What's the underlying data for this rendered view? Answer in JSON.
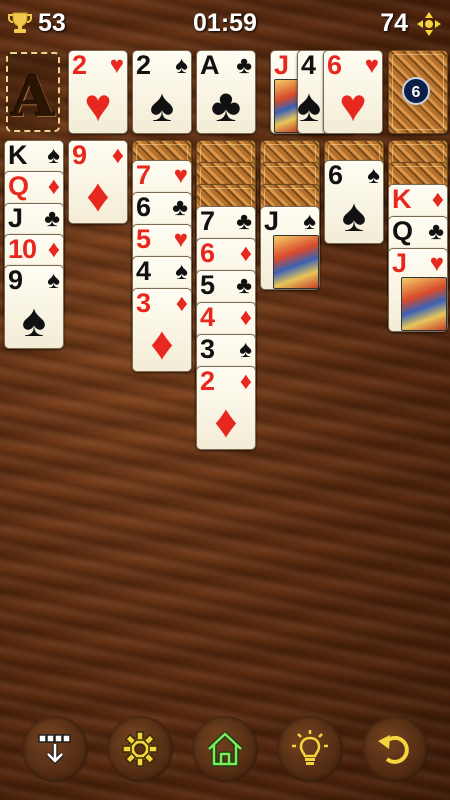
{
  "hud": {
    "score": "53",
    "timer": "01:59",
    "moves": "74"
  },
  "foundation": {
    "placeholder": "A"
  },
  "stock": {
    "remaining": "6"
  },
  "waste": [
    {
      "rank": "J",
      "suit": "♠",
      "color": "red"
    },
    {
      "rank": "4",
      "suit": "♠",
      "color": "black"
    },
    {
      "rank": "6",
      "suit": "♥",
      "color": "red"
    }
  ],
  "top_cards": [
    {
      "rank": "2",
      "suit": "♥",
      "color": "red"
    },
    {
      "rank": "2",
      "suit": "♠",
      "color": "black"
    },
    {
      "rank": "A",
      "suit": "♣",
      "color": "black"
    }
  ],
  "tableau": {
    "col1": [
      {
        "rank": "K",
        "suit": "♠",
        "color": "black"
      },
      {
        "rank": "Q",
        "suit": "♦",
        "color": "red"
      },
      {
        "rank": "J",
        "suit": "♣",
        "color": "black"
      },
      {
        "rank": "10",
        "suit": "♦",
        "color": "red"
      },
      {
        "rank": "9",
        "suit": "♠",
        "color": "black"
      }
    ],
    "col2": [
      {
        "rank": "9",
        "suit": "♦",
        "color": "red"
      }
    ],
    "col3": [
      {
        "rank": "7",
        "suit": "♥",
        "color": "red"
      },
      {
        "rank": "6",
        "suit": "♣",
        "color": "black"
      },
      {
        "rank": "5",
        "suit": "♥",
        "color": "red"
      },
      {
        "rank": "4",
        "suit": "♠",
        "color": "black"
      },
      {
        "rank": "3",
        "suit": "♦",
        "color": "red"
      }
    ],
    "col4": [
      {
        "rank": "7",
        "suit": "♣",
        "color": "black"
      },
      {
        "rank": "6",
        "suit": "♦",
        "color": "red"
      },
      {
        "rank": "5",
        "suit": "♣",
        "color": "black"
      },
      {
        "rank": "4",
        "suit": "♦",
        "color": "red"
      },
      {
        "rank": "3",
        "suit": "♠",
        "color": "black"
      },
      {
        "rank": "2",
        "suit": "♦",
        "color": "red"
      }
    ],
    "col5": [
      {
        "rank": "J",
        "suit": "♠",
        "color": "black"
      }
    ],
    "col6": [
      {
        "rank": "6",
        "suit": "♠",
        "color": "black"
      }
    ],
    "col7": [
      {
        "rank": "K",
        "suit": "♦",
        "color": "red"
      },
      {
        "rank": "Q",
        "suit": "♣",
        "color": "black"
      },
      {
        "rank": "J",
        "suit": "♥",
        "color": "red"
      }
    ]
  },
  "toolbar": {
    "buttons": [
      "auto-complete",
      "settings",
      "home",
      "hint",
      "undo"
    ]
  },
  "colors": {
    "red_suit": "#e8281e",
    "black_suit": "#111111",
    "hint_icon": "#f5d53c",
    "home_icon": "#7dec5a"
  }
}
